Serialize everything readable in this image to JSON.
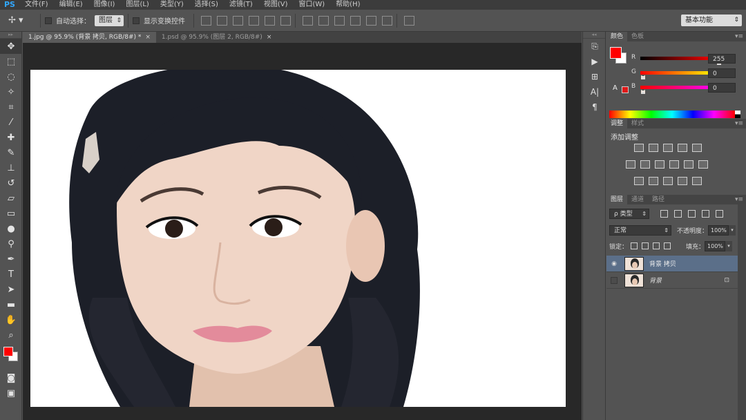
{
  "app": {
    "logo": "PS"
  },
  "menu": [
    "文件(F)",
    "编辑(E)",
    "图像(I)",
    "图层(L)",
    "类型(Y)",
    "选择(S)",
    "滤镜(T)",
    "视图(V)",
    "窗口(W)",
    "帮助(H)"
  ],
  "options": {
    "auto_select_label": "自动选择：",
    "auto_select_value": "图层",
    "show_transform_label": "显示变换控件",
    "workspace": "基本功能"
  },
  "tabs": [
    {
      "label": "1.jpg @ 95.9% (背景 拷贝, RGB/8#) *",
      "close": "×"
    },
    {
      "label": "1.psd @ 95.9% (图层 2, RGB/8#)",
      "close": "×"
    }
  ],
  "color_panel": {
    "tabs": [
      "颜色",
      "色板"
    ],
    "rows": [
      {
        "label": "R",
        "value": "255",
        "gradient": "linear-gradient(to right, #000, #ff0000)",
        "level": 1.0
      },
      {
        "label": "G",
        "value": "0",
        "gradient": "linear-gradient(to right, #ff0000, #ffff00)",
        "level": 0.0
      },
      {
        "label": "B",
        "value": "0",
        "gradient": "linear-gradient(to right, #ff0000, #ff00ff)",
        "level": 0.0
      }
    ],
    "foreground": "#ff0000",
    "background": "#ffffff",
    "warning_glyph": "A"
  },
  "adjust_panel": {
    "tabs": [
      "调整",
      "样式"
    ],
    "title": "添加调整"
  },
  "layers_panel": {
    "tabs": [
      "图层",
      "通道",
      "路径"
    ],
    "kind": "ρ 类型",
    "blend_mode": "正常",
    "opacity_label": "不透明度：",
    "opacity": "100%",
    "lock_label": "锁定：",
    "fill_label": "填充：",
    "fill": "100%",
    "layers": [
      {
        "name": "背景 拷贝",
        "visible": true,
        "selected": true
      },
      {
        "name": "背景",
        "visible": false,
        "selected": false,
        "locked": true
      }
    ],
    "lock_glyph": "🔒",
    "eye_glyph": "👁"
  }
}
